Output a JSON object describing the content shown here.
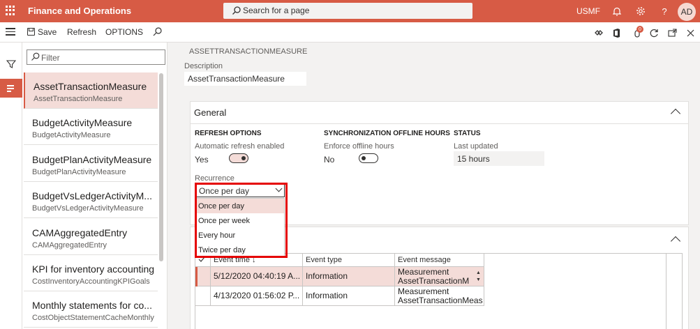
{
  "topbar": {
    "app_title": "Finance and Operations",
    "search_placeholder": "Search for a page",
    "company": "USMF",
    "avatar": "AD",
    "help": "?"
  },
  "actionbar": {
    "save": "Save",
    "refresh": "Refresh",
    "options": "OPTIONS",
    "notification_count": "0"
  },
  "listpane": {
    "filter_placeholder": "Filter",
    "items": [
      {
        "title": "AssetTransactionMeasure",
        "subtitle": "AssetTransactionMeasure"
      },
      {
        "title": "BudgetActivityMeasure",
        "subtitle": "BudgetActivityMeasure"
      },
      {
        "title": "BudgetPlanActivityMeasure",
        "subtitle": "BudgetPlanActivityMeasure"
      },
      {
        "title": "BudgetVsLedgerActivityM...",
        "subtitle": "BudgetVsLedgerActivityMeasure"
      },
      {
        "title": "CAMAggregatedEntry",
        "subtitle": "CAMAggregatedEntry"
      },
      {
        "title": "KPI for inventory accounting",
        "subtitle": "CostInventoryAccountingKPIGoals"
      },
      {
        "title": "Monthly statements for co...",
        "subtitle": "CostObjectStatementCacheMonthly"
      }
    ]
  },
  "detail": {
    "breadcrumb": "ASSETTRANSACTIONMEASURE",
    "description_label": "Description",
    "description_value": "AssetTransactionMeasure"
  },
  "general": {
    "title": "General",
    "refresh_header": "REFRESH OPTIONS",
    "auto_refresh_label": "Automatic refresh enabled",
    "auto_refresh_value": "Yes",
    "sync_header": "SYNCHRONIZATION OFFLINE HOURS",
    "offline_label": "Enforce offline hours",
    "offline_value": "No",
    "status_header": "STATUS",
    "last_updated_label": "Last updated",
    "last_updated_value": "15 hours",
    "recurrence_label": "Recurrence",
    "recurrence_value": "Once per day",
    "recurrence_options": [
      "Once per day",
      "Once per week",
      "Every hour",
      "Twice per day"
    ]
  },
  "events": {
    "columns": [
      "Event time",
      "Event type",
      "Event message"
    ],
    "sort_arrow": "↓",
    "rows": [
      {
        "time": "5/12/2020 04:40:19 A...",
        "type": "Information",
        "msg1": "Measurement",
        "msg2": "AssetTransactionM"
      },
      {
        "time": "4/13/2020 01:56:02 P...",
        "type": "Information",
        "msg1": "Measurement",
        "msg2": "AssetTransactionMeas"
      }
    ]
  },
  "colors": {
    "brand": "#d75b45",
    "selected": "#f4dcd8",
    "highlight_box": "#e50000"
  }
}
